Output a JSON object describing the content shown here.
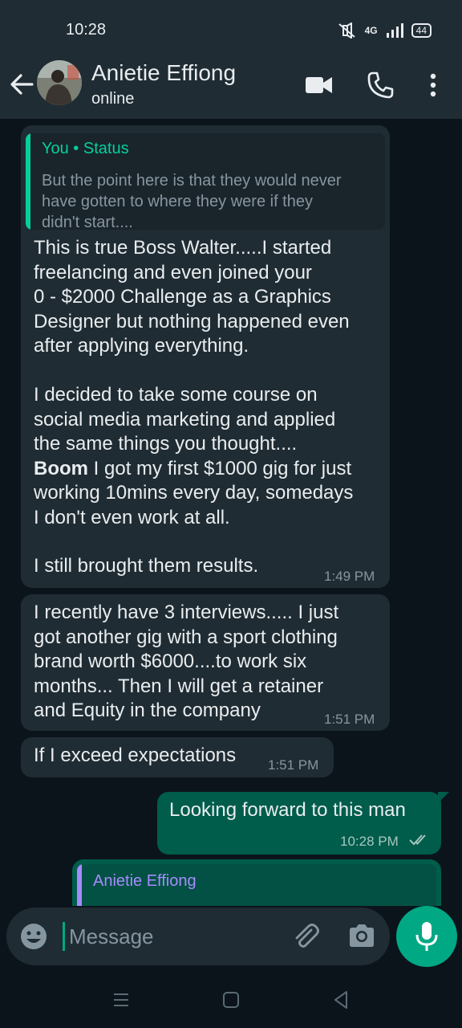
{
  "status_bar": {
    "time": "10:28",
    "network": "4G",
    "battery": "44"
  },
  "header": {
    "contact_name": "Anietie Effiong",
    "contact_status": "online"
  },
  "messages": [
    {
      "direction": "incoming",
      "quote": {
        "title": "You • Status",
        "text_lines": [
          "But the point here is that they would never",
          "have gotten to where they were if they",
          "didn't start...."
        ]
      },
      "paragraph1": "This is true Boss Walter.....I started\nfreelancing and even joined your\n0 - $2000 Challenge as a Graphics\nDesigner but nothing happened even\nafter applying everything.",
      "paragraph2_start": "I decided to take some course on\nsocial media marketing and applied\nthe same things you thought....",
      "bold_word": "Boom",
      "paragraph2_end": " I got my first $1000 gig for just\nworking 10mins every day, somedays\nI don't even work at all.",
      "paragraph3": "I still brought them results.",
      "time": "1:49 PM"
    },
    {
      "direction": "incoming",
      "text": "I recently have 3 interviews..... I just\ngot another gig with a sport clothing\nbrand worth $6000....to work six\nmonths... Then I will get a retainer\nand Equity in the company",
      "time": "1:51 PM"
    },
    {
      "direction": "incoming",
      "text": "If I exceed expectations",
      "time": "1:51 PM"
    },
    {
      "direction": "outgoing",
      "text": "Looking forward to this man",
      "time": "10:28 PM",
      "status": "read"
    },
    {
      "direction": "outgoing",
      "quote": {
        "title": "Anietie Effiong"
      }
    }
  ],
  "input": {
    "placeholder": "Message"
  },
  "colors": {
    "background": "#0b141a",
    "bar": "#1f2c34",
    "incoming_bubble": "#202c33",
    "outgoing_bubble": "#005c4b",
    "accent": "#00a884",
    "quote_green": "#06cf9c",
    "quote_purple": "#a68bff",
    "read_ticks": "#a7c7bf"
  },
  "icons": [
    "back-arrow-icon",
    "video-call-icon",
    "phone-icon",
    "more-vert-icon",
    "emoji-icon",
    "attach-icon",
    "camera-icon",
    "mic-icon",
    "menu-icon",
    "home-icon",
    "back-icon"
  ]
}
